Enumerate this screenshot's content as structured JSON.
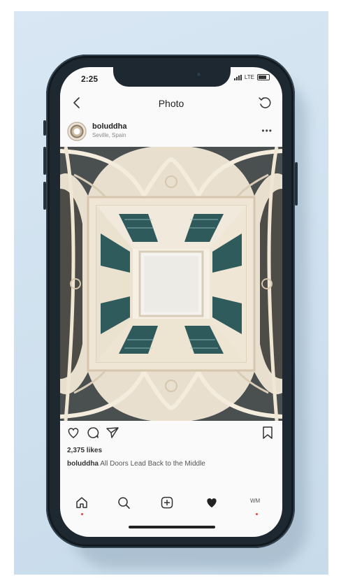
{
  "status": {
    "time": "2:25",
    "network": "LTE"
  },
  "nav": {
    "title": "Photo"
  },
  "post": {
    "username": "boluddha",
    "location": "Seville, Spain",
    "likes": "2,375 likes",
    "caption_user": "boluddha",
    "caption_text": "All Doors Lead Back to the Middle"
  },
  "tabbar": {
    "profile_label": "WM"
  },
  "icons": {
    "back": "chevron-left-icon",
    "refresh": "refresh-icon",
    "more": "more-dots-icon",
    "like": "heart-icon",
    "comment": "comment-icon",
    "share": "send-icon",
    "save": "bookmark-icon",
    "home": "home-icon",
    "search": "search-icon",
    "add": "add-post-icon",
    "activity": "heart-filled-icon"
  },
  "colors": {
    "background": "#cfe0ee",
    "phone_body": "#1e2830",
    "screen": "#fafafa",
    "accent_dot": "#d9484a"
  }
}
